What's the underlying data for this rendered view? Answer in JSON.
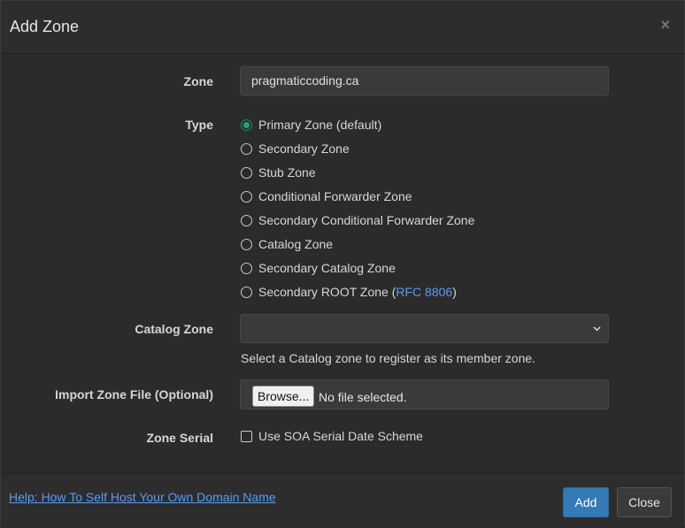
{
  "dialog": {
    "title": "Add Zone",
    "close_glyph": "×"
  },
  "form": {
    "zone": {
      "label": "Zone",
      "value": "pragmaticcoding.ca"
    },
    "type": {
      "label": "Type",
      "selected": "Primary Zone (default)",
      "options": [
        {
          "label": "Primary Zone (default)",
          "checked": true
        },
        {
          "label": "Secondary Zone",
          "checked": false
        },
        {
          "label": "Stub Zone",
          "checked": false
        },
        {
          "label": "Conditional Forwarder Zone",
          "checked": false
        },
        {
          "label": "Secondary Conditional Forwarder Zone",
          "checked": false
        },
        {
          "label": "Catalog Zone",
          "checked": false
        },
        {
          "label": "Secondary Catalog Zone",
          "checked": false
        },
        {
          "label": "Secondary ROOT Zone (",
          "checked": false,
          "link": "RFC 8806",
          "suffix": ")"
        }
      ]
    },
    "catalog_zone": {
      "label": "Catalog Zone",
      "selected_value": "",
      "help": "Select a Catalog zone to register as its member zone."
    },
    "import_zone_file": {
      "label": "Import Zone File (Optional)",
      "browse_label": "Browse...",
      "status": "No file selected."
    },
    "zone_serial": {
      "label": "Zone Serial",
      "checkbox_label": "Use SOA Serial Date Scheme",
      "checked": false
    }
  },
  "footer": {
    "help_link": "Help: How To Self Host Your Own Domain Name",
    "add_label": "Add",
    "close_label": "Close"
  },
  "colors": {
    "accent_radio": "#20a37c",
    "primary_button": "#337ab7",
    "link": "#5a9cf0"
  }
}
